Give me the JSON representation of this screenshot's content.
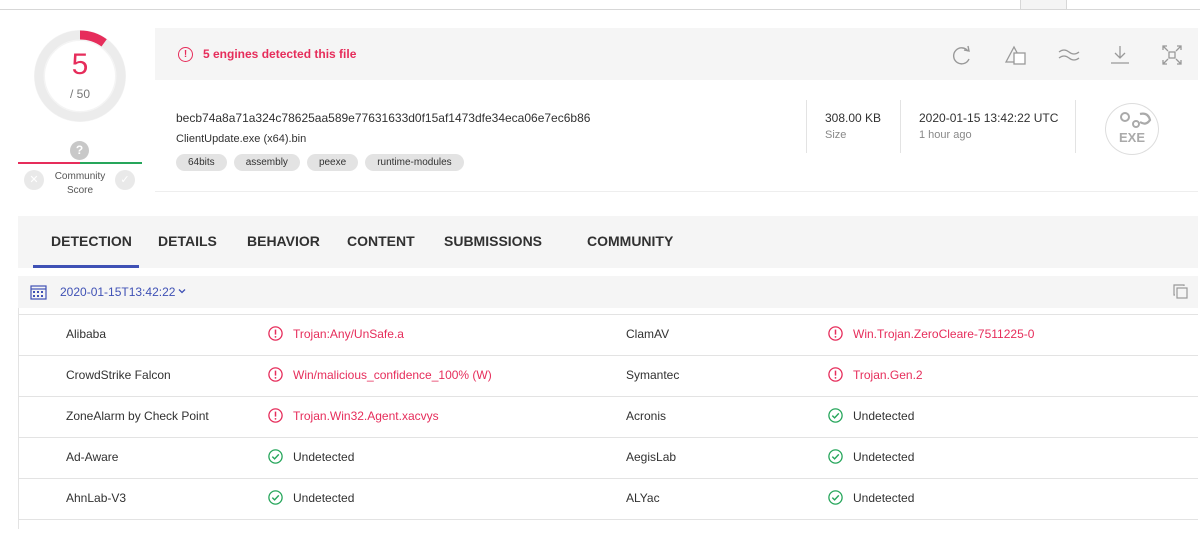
{
  "score": {
    "detected": "5",
    "total": "/ 50",
    "community_label": "Community Score",
    "community_question": "?"
  },
  "alert": {
    "text": "5 engines detected this file"
  },
  "file": {
    "hash": "becb74a8a71a324c78625aa589e77631633d0f15af1473dfe34eca06e7ec6b86",
    "name": "ClientUpdate.exe (x64).bin",
    "tags": [
      "64bits",
      "assembly",
      "peexe",
      "runtime-modules"
    ],
    "size_value": "308.00 KB",
    "size_label": "Size",
    "date_value": "2020-01-15 13:42:22 UTC",
    "date_label": "1 hour ago",
    "type_icon_label": "EXE"
  },
  "toolbar": {
    "icons": [
      "reanalyze-icon",
      "similar-icon",
      "graph-icon",
      "download-icon",
      "expand-icon"
    ]
  },
  "tabs": [
    {
      "label": "DETECTION",
      "active": true
    },
    {
      "label": "DETAILS",
      "active": false
    },
    {
      "label": "BEHAVIOR",
      "active": false
    },
    {
      "label": "CONTENT",
      "active": false
    },
    {
      "label": "SUBMISSIONS",
      "active": false
    },
    {
      "label": "COMMUNITY",
      "active": false
    }
  ],
  "analysis_date": "2020-01-15T13:42:22",
  "colors": {
    "malicious": "#e62d5b",
    "clean": "#26a65b",
    "accent": "#3f51b5"
  },
  "detections": [
    [
      {
        "engine": "Alibaba",
        "result": "Trojan:Any/UnSafe.a",
        "status": "malicious"
      },
      {
        "engine": "ClamAV",
        "result": "Win.Trojan.ZeroCleare-7511225-0",
        "status": "malicious"
      }
    ],
    [
      {
        "engine": "CrowdStrike Falcon",
        "result": "Win/malicious_confidence_100% (W)",
        "status": "malicious"
      },
      {
        "engine": "Symantec",
        "result": "Trojan.Gen.2",
        "status": "malicious"
      }
    ],
    [
      {
        "engine": "ZoneAlarm by Check Point",
        "result": "Trojan.Win32.Agent.xacvys",
        "status": "malicious"
      },
      {
        "engine": "Acronis",
        "result": "Undetected",
        "status": "clean"
      }
    ],
    [
      {
        "engine": "Ad-Aware",
        "result": "Undetected",
        "status": "clean"
      },
      {
        "engine": "AegisLab",
        "result": "Undetected",
        "status": "clean"
      }
    ],
    [
      {
        "engine": "AhnLab-V3",
        "result": "Undetected",
        "status": "clean"
      },
      {
        "engine": "ALYac",
        "result": "Undetected",
        "status": "clean"
      }
    ]
  ]
}
